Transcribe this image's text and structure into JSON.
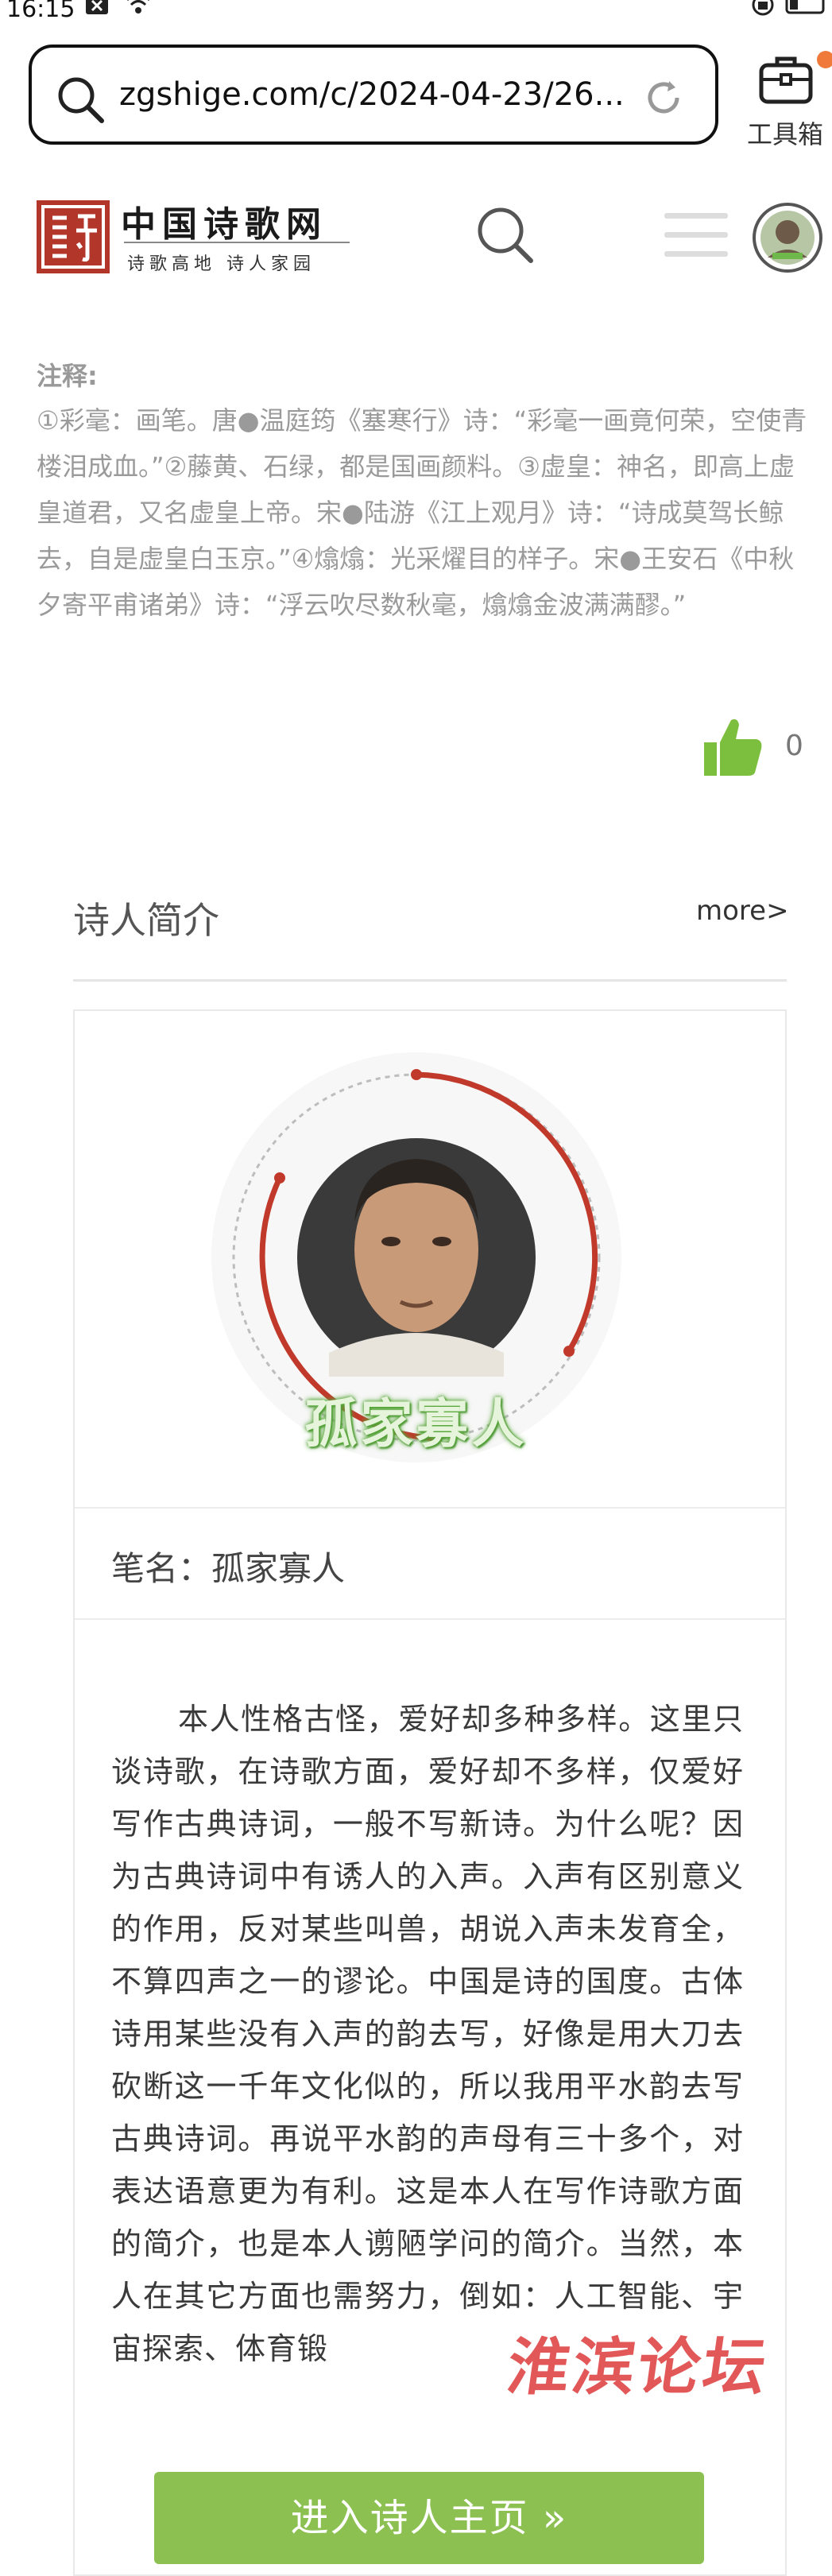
{
  "status_bar": {
    "time": "16:15"
  },
  "browser": {
    "url": "zgshige.com/c/2024-04-23/26...",
    "toolbox_label": "工具箱"
  },
  "site": {
    "logo_title": "中国诗歌网",
    "logo_subtitle": "诗歌高地 诗人家园"
  },
  "notes": {
    "title": "注释:",
    "body": "①彩毫：画笔。唐●温庭筠《塞寒行》诗：“彩毫一画竟何荣，空使青楼泪成血。”②藤黄、石绿，都是国画颜料。③虚皇：神名，即高上虚皇道君，又名虚皇上帝。宋●陆游《江上观月》诗：“诗成莫驾长鲸去，自是虚皇白玉京。”④熻熻：光采燿目的样子。宋●王安石《中秋夕寄平甫诸弟》诗：“浮云吹尽数秋毫，熻熻金波满满醪。”",
    "like_count": "0"
  },
  "poet_intro": {
    "heading": "诗人简介",
    "more_label": "more>",
    "avatar_name": "孤家寡人",
    "pen_name": "笔名：孤家寡人",
    "bio": "本人性格古怪，爱好却多种多样。这里只谈诗歌，在诗歌方面，爱好却不多样，仅爱好写作古典诗词，一般不写新诗。为什么呢？因为古典诗词中有诱人的入声。入声有区别意义的作用，反对某些叫兽，胡说入声未发育全，不算四声之一的谬论。中国是诗的国度。古体诗用某些没有入声的韵去写，好像是用大刀去砍断这一千年文化似的，所以我用平水韵去写古典诗词。再说平水韵的声母有三十多个，对表达语意更为有利。这是本人在写作诗歌方面的简介，也是本人谫陋学问的简介。当然，本人在其它方面也需努力，倒如：人工智能、宇宙探索、体育锻",
    "enter_button": "进入诗人主页 »"
  },
  "watermark": "淮滨论坛",
  "colors": {
    "accent_green": "#8cc152",
    "logo_red": "#b3362b",
    "watermark_red": "#dc3232"
  }
}
